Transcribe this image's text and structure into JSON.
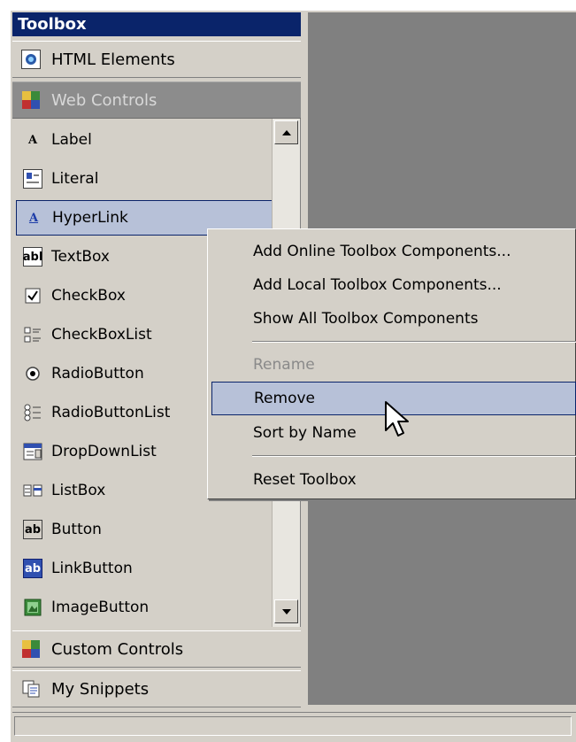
{
  "toolbox": {
    "title": "Toolbox",
    "groups": {
      "html_elements": "HTML Elements",
      "web_controls": "Web Controls",
      "custom_controls": "Custom Controls",
      "my_snippets": "My Snippets"
    },
    "items": [
      {
        "label": "Label",
        "icon": "label-A-icon"
      },
      {
        "label": "Literal",
        "icon": "literal-icon"
      },
      {
        "label": "HyperLink",
        "icon": "hyperlink-A-icon",
        "selected": true
      },
      {
        "label": "TextBox",
        "icon": "textbox-icon",
        "glyph": "abl"
      },
      {
        "label": "CheckBox",
        "icon": "checkbox-icon"
      },
      {
        "label": "CheckBoxList",
        "icon": "checkboxlist-icon"
      },
      {
        "label": "RadioButton",
        "icon": "radiobutton-icon"
      },
      {
        "label": "RadioButtonList",
        "icon": "radiobuttonlist-icon"
      },
      {
        "label": "DropDownList",
        "icon": "dropdownlist-icon"
      },
      {
        "label": "ListBox",
        "icon": "listbox-icon"
      },
      {
        "label": "Button",
        "icon": "button-icon",
        "glyph": "ab"
      },
      {
        "label": "LinkButton",
        "icon": "linkbutton-icon",
        "glyph": "ab"
      },
      {
        "label": "ImageButton",
        "icon": "imagebutton-icon"
      }
    ]
  },
  "context_menu": {
    "items": [
      {
        "label": "Add Online Toolbox Components...",
        "state": "enabled"
      },
      {
        "label": "Add Local Toolbox Components...",
        "state": "enabled"
      },
      {
        "label": "Show All Toolbox Components",
        "state": "enabled"
      },
      {
        "label": "Rename",
        "state": "disabled"
      },
      {
        "label": "Remove",
        "state": "highlighted"
      },
      {
        "label": "Sort by Name",
        "state": "enabled"
      },
      {
        "label": "Reset Toolbox",
        "state": "enabled"
      }
    ]
  },
  "colors": {
    "titlebar": "#0a246a",
    "face": "#d4d0c8",
    "selection": "#b7c1d8",
    "workspace": "#808080"
  }
}
